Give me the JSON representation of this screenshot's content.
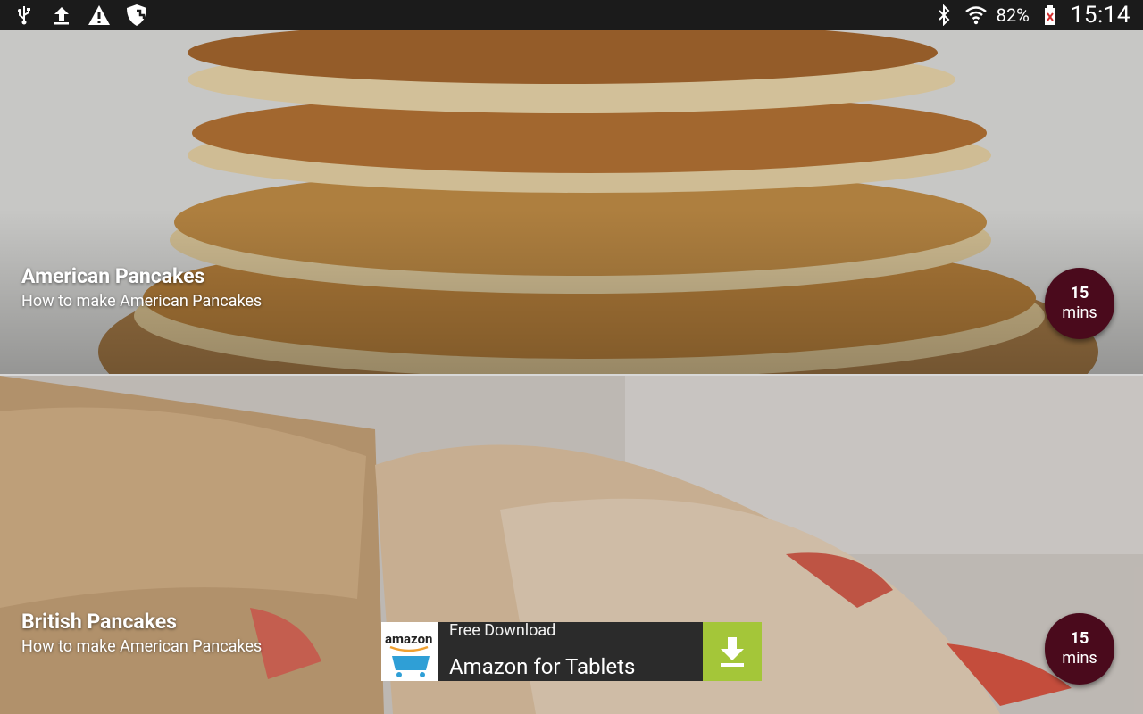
{
  "statusbar": {
    "battery_pct": "82%",
    "clock": "15:14",
    "left_icons": [
      "usb-icon",
      "upload-icon",
      "warning-icon",
      "shield-icon"
    ],
    "right_icons": [
      "bluetooth-icon",
      "wifi-icon",
      "battery-icon"
    ]
  },
  "recipes": [
    {
      "title": "American Pancakes",
      "subtitle": "How to make American Pancakes",
      "time_value": "15",
      "time_unit": "mins"
    },
    {
      "title": "British Pancakes",
      "subtitle": "How to make American Pancakes",
      "time_value": "15",
      "time_unit": "mins"
    }
  ],
  "ad": {
    "brand": "amazon",
    "line1": "Free Download",
    "line2": "Amazon for Tablets",
    "button_icon": "download-icon",
    "button_color": "#a4c639"
  },
  "colors": {
    "badge": "#4a0a1c",
    "statusbar": "#1b1b1b"
  }
}
